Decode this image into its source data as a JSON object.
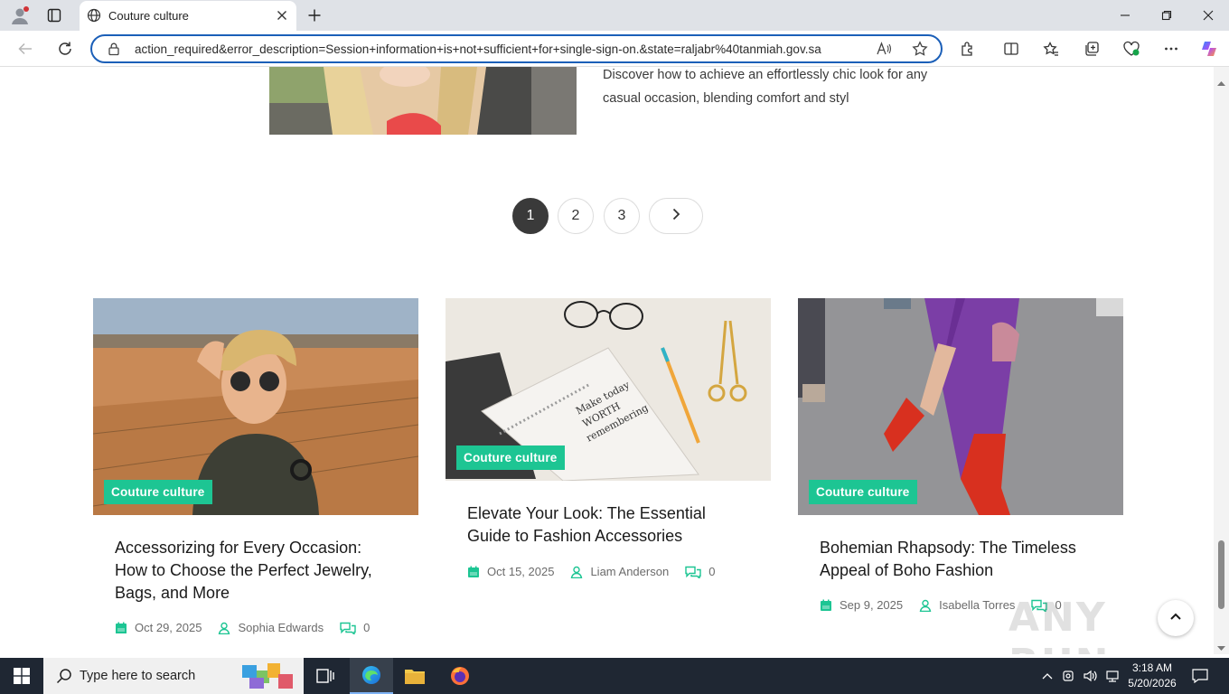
{
  "browser": {
    "tab_title": "Couture culture",
    "url": "action_required&error_description=Session+information+is+not+sufficient+for+single-sign-on.&state=raljabr%40tanmiah.gov.sa"
  },
  "page": {
    "top_excerpt": "Discover how to achieve an effortlessly chic look for any casual occasion, blending comfort and styl",
    "pagination": {
      "pages": [
        "1",
        "2",
        "3"
      ],
      "current": "1",
      "next_icon": "chevron-right-icon"
    },
    "cards": [
      {
        "category": "Couture culture",
        "title": "Accessorizing for Every Occasion: How to Choose the Perfect Jewelry, Bags, and More",
        "date": "Oct 29, 2025",
        "author": "Sophia Edwards",
        "comments": "0"
      },
      {
        "category": "Couture culture",
        "title": "Elevate Your Look: The Essential Guide to Fashion Accessories",
        "date": "Oct 15, 2025",
        "author": "Liam Anderson",
        "comments": "0"
      },
      {
        "category": "Couture culture",
        "title": "Bohemian Rhapsody: The Timeless Appeal of Boho Fashion",
        "date": "Sep 9, 2025",
        "author": "Isabella Torres",
        "comments": "0"
      }
    ],
    "accent_color": "#1dc593",
    "watermark": "ANY RUN"
  },
  "taskbar": {
    "search_placeholder": "Type here to search",
    "time": "3:18 AM",
    "date": "5/20/2026"
  }
}
